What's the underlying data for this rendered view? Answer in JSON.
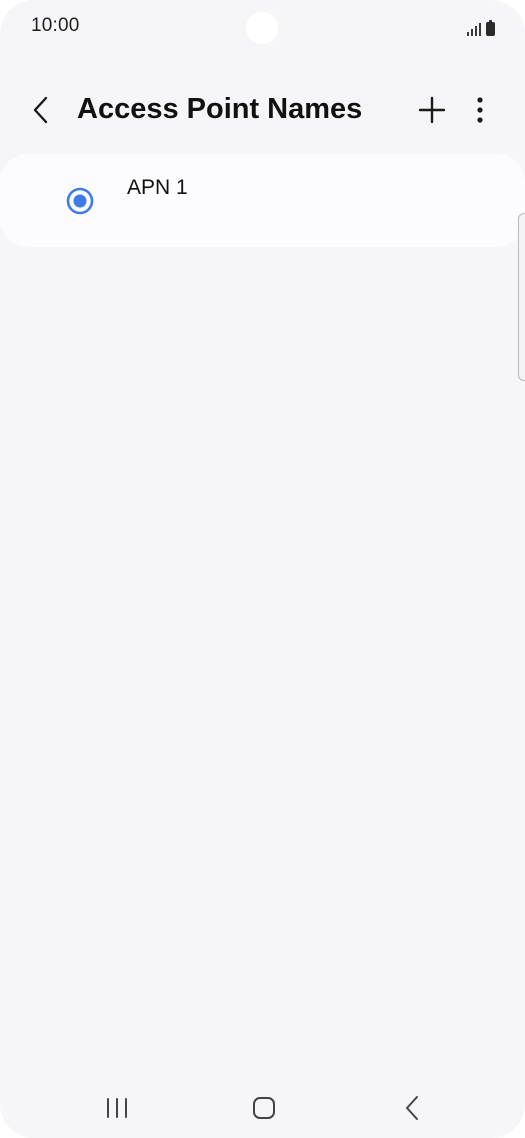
{
  "status_bar": {
    "time": "10:00",
    "icons": [
      "signal-icon",
      "battery-icon"
    ]
  },
  "app_bar": {
    "title": "Access Point Names",
    "back_icon": "chevron-left-icon",
    "add_icon": "plus-icon",
    "more_icon": "more-vertical-icon"
  },
  "apn_list": {
    "items": [
      {
        "name": "APN 1",
        "selected": true
      }
    ]
  },
  "nav_bar": {
    "recents_icon": "recents-icon",
    "home_icon": "home-icon",
    "back_icon": "back-icon"
  },
  "colors": {
    "background": "#f6f6f8",
    "card": "#fcfcfe",
    "accent": "#3e7be9",
    "text": "#111111"
  }
}
